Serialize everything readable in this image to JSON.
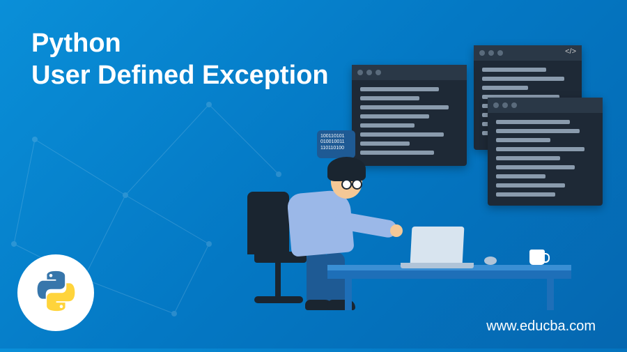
{
  "title": "Python\nUser Defined Exception",
  "url": "www.educba.com",
  "speech_text": "100110101\n010010011\n110110100",
  "colors": {
    "bg_gradient_start": "#0a8fd8",
    "bg_gradient_end": "#0567b0",
    "code_window_bg": "#1e2936",
    "text_color": "#ffffff"
  },
  "logo_name": "python-logo"
}
